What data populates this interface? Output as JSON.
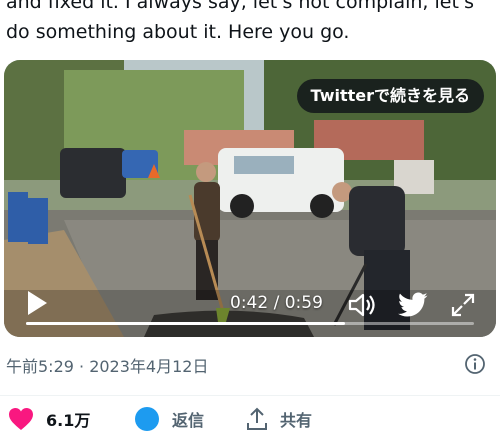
{
  "tweet": {
    "text": "and fixed it. I always say, let's not complain, let's do something about it. Here you go."
  },
  "video": {
    "continue_label": "Twitterで続きを見る",
    "current_time": "0:42",
    "duration": "0:59",
    "time_separator": " / ",
    "progress_fraction": 0.712,
    "icons": {
      "play": "play-icon",
      "volume": "volume-icon",
      "brand": "twitter-bird-icon",
      "fullscreen": "fullscreen-icon"
    }
  },
  "meta": {
    "timestamp": "午前5:29 · 2023年4月12日",
    "info_icon": "info-icon"
  },
  "actions": {
    "likes_count": "6.1万",
    "reply_label": "返信",
    "share_label": "共有"
  },
  "colors": {
    "like": "#f91880",
    "reply": "#1d9bf0",
    "meta_text": "#536471"
  }
}
